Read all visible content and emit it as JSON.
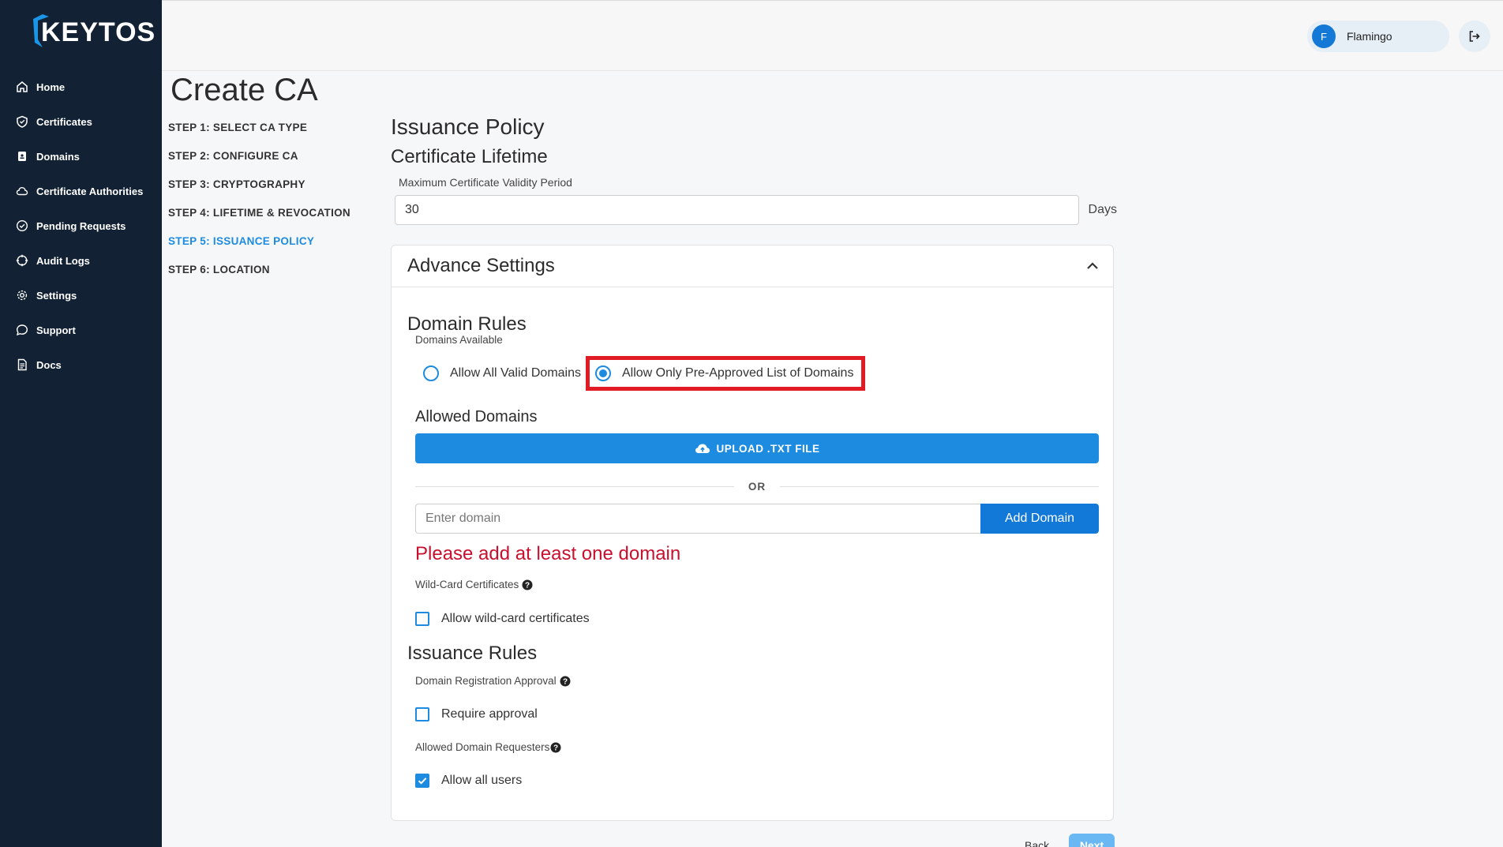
{
  "app": {
    "logo": "KEYTOS"
  },
  "sidebar": {
    "items": [
      {
        "label": "Home",
        "icon": "home-icon"
      },
      {
        "label": "Certificates",
        "icon": "shield-icon"
      },
      {
        "label": "Domains",
        "icon": "domain-icon"
      },
      {
        "label": "Certificate Authorities",
        "icon": "cloud-icon"
      },
      {
        "label": "Pending Requests",
        "icon": "check-circle-icon"
      },
      {
        "label": "Audit Logs",
        "icon": "crosshair-icon"
      },
      {
        "label": "Settings",
        "icon": "gear-icon"
      },
      {
        "label": "Support",
        "icon": "chat-icon"
      },
      {
        "label": "Docs",
        "icon": "document-icon"
      }
    ]
  },
  "header": {
    "user_initial": "F",
    "user_name": "Flamingo"
  },
  "page": {
    "title": "Create CA"
  },
  "steps": [
    {
      "label": "STEP 1: SELECT CA TYPE",
      "active": false
    },
    {
      "label": "STEP 2: CONFIGURE CA",
      "active": false
    },
    {
      "label": "STEP 3: CRYPTOGRAPHY",
      "active": false
    },
    {
      "label": "STEP 4: LIFETIME & REVOCATION",
      "active": false
    },
    {
      "label": "STEP 5: ISSUANCE POLICY",
      "active": true
    },
    {
      "label": "STEP 6: LOCATION",
      "active": false
    }
  ],
  "issuance": {
    "heading": "Issuance Policy",
    "lifetime_heading": "Certificate Lifetime",
    "validity_label": "Maximum Certificate Validity Period",
    "validity_value": "30",
    "validity_unit": "Days"
  },
  "advanced": {
    "title": "Advance Settings",
    "domain_rules": {
      "title": "Domain Rules",
      "available_label": "Domains Available",
      "option_all": "Allow All Valid Domains",
      "option_preapproved": "Allow Only Pre-Approved List of Domains",
      "selected": "preapproved"
    },
    "allowed_domains": {
      "title": "Allowed Domains",
      "upload_label": "UPLOAD .TXT FILE",
      "or_text": "OR",
      "input_placeholder": "Enter domain",
      "add_label": "Add Domain",
      "error": "Please add at least one domain"
    },
    "wildcard": {
      "label": "Wild-Card Certificates",
      "checkbox_label": "Allow wild-card certificates",
      "checked": false
    },
    "issuance_rules": {
      "title": "Issuance Rules",
      "approval_label": "Domain Registration Approval",
      "approval_checkbox": "Require approval",
      "approval_checked": false,
      "requesters_label": "Allowed Domain Requesters",
      "requesters_checkbox": "Allow all users",
      "requesters_checked": true
    }
  },
  "footer": {
    "back_label": "Back",
    "next_label": "Next"
  },
  "colors": {
    "sidebar_bg": "#122133",
    "accent": "#1d8be0",
    "error": "#c8102e",
    "highlight": "#e01b24"
  }
}
